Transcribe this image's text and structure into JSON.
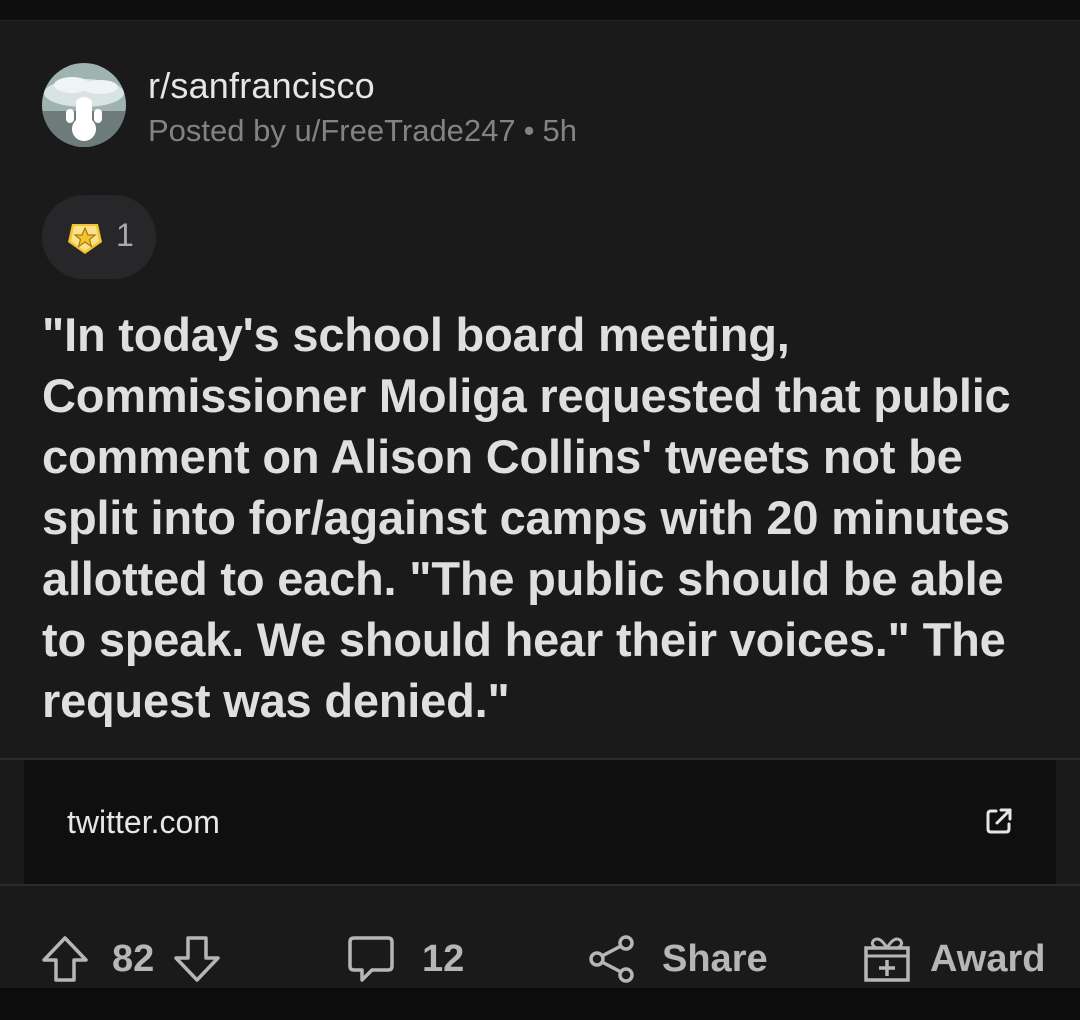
{
  "post": {
    "subreddit": "r/sanfrancisco",
    "posted_by_prefix": "Posted by",
    "author": "u/FreeTrade247",
    "separator": "•",
    "age": "5h",
    "award_count": "1",
    "title": "\"In today's school board meeting, Commissioner Moliga requested that public comment on Alison Collins' tweets not be split into for/against camps with 20 minutes allotted to each. \"The public should be able to speak. We should hear their voices.\" The request was denied.\"",
    "link_domain": "twitter.com"
  },
  "actions": {
    "score": "82",
    "comments": "12",
    "share_label": "Share",
    "award_label": "Award"
  },
  "icons": {
    "avatar": "subreddit-avatar-icon",
    "award_badge": "gold-star-award-icon",
    "external": "external-link-icon",
    "upvote": "upvote-arrow-icon",
    "downvote": "downvote-arrow-icon",
    "comment": "comment-bubble-icon",
    "share": "share-icon",
    "award": "gift-award-icon"
  },
  "colors": {
    "background": "#1a1a1b",
    "text_primary": "#dedfe0",
    "text_meta": "#818384",
    "award_gold": "#f4c430"
  }
}
